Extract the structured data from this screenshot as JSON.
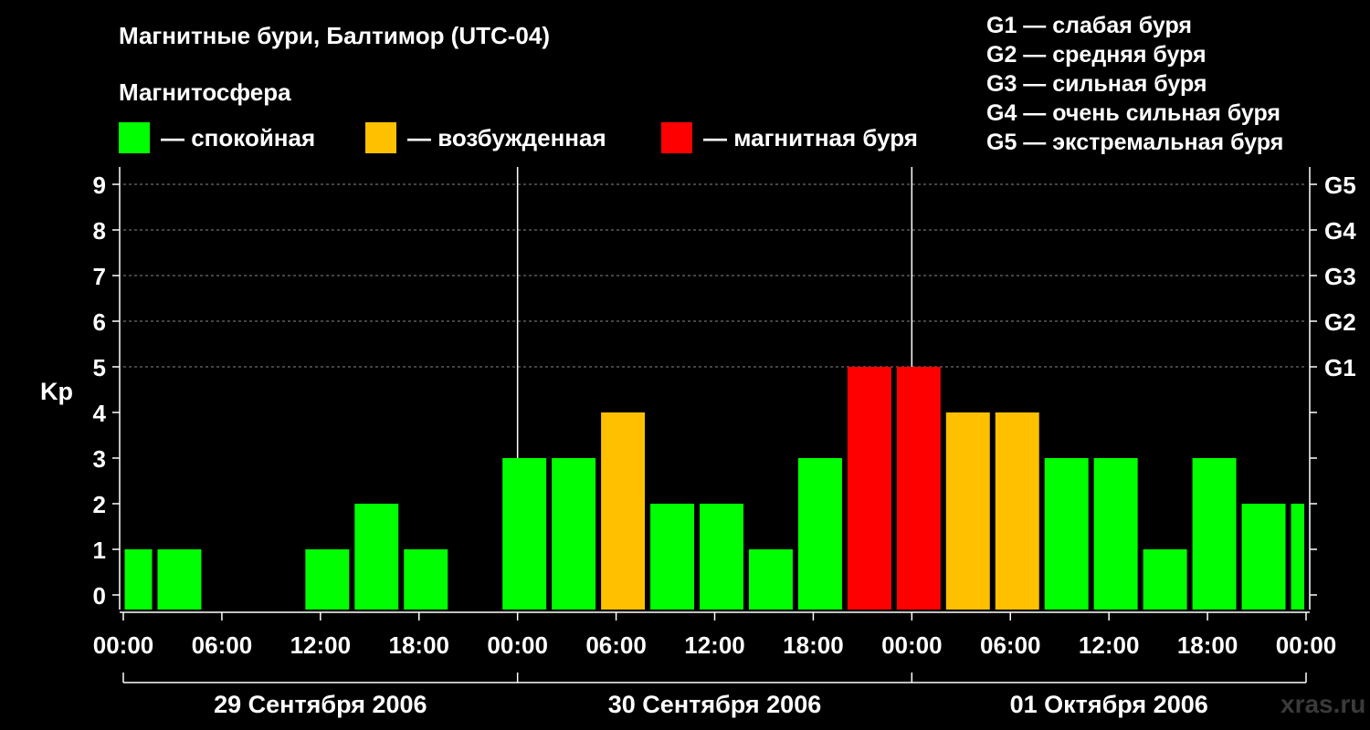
{
  "header": {
    "title": "Магнитные бури, Балтимор (UTC-04)",
    "subtitle": "Магнитосфера"
  },
  "legend": [
    {
      "label": "— спокойная",
      "color": "#00ff00"
    },
    {
      "label": "— возбужденная",
      "color": "#ffc000"
    },
    {
      "label": "— магнитная буря",
      "color": "#ff0000"
    }
  ],
  "g_legend": [
    "G1 — слабая буря",
    "G2 — средняя буря",
    "G3 — сильная буря",
    "G4 — очень сильная буря",
    "G5 — экстремальная буря"
  ],
  "watermark": "xras.ru",
  "chart_data": {
    "type": "bar",
    "ylabel": "Kp",
    "ylim": [
      0,
      9
    ],
    "yticks": [
      "0",
      "1",
      "2",
      "3",
      "4",
      "5",
      "6",
      "7",
      "8",
      "9"
    ],
    "g_scale": [
      {
        "label": "G1",
        "kp": 5
      },
      {
        "label": "G2",
        "kp": 6
      },
      {
        "label": "G3",
        "kp": 7
      },
      {
        "label": "G4",
        "kp": 8
      },
      {
        "label": "G5",
        "kp": 9
      }
    ],
    "xticks": [
      "00:00",
      "06:00",
      "12:00",
      "18:00",
      "00:00",
      "06:00",
      "12:00",
      "18:00",
      "00:00",
      "06:00",
      "12:00",
      "18:00",
      "00:00"
    ],
    "days": [
      "29 Сентября 2006",
      "30 Сентября 2006",
      "01 Октября 2006"
    ],
    "grid": "dashed horizontal lines at Kp 5-9",
    "colors": {
      "quiet": "#00ff00",
      "active": "#ffc000",
      "storm": "#ff0000"
    },
    "bars": [
      {
        "start": "2006-09-29 00:00",
        "end": "2006-09-29 02:00",
        "kp": 1
      },
      {
        "start": "2006-09-29 02:00",
        "end": "2006-09-29 05:00",
        "kp": 1
      },
      {
        "start": "2006-09-29 05:00",
        "end": "2006-09-29 08:00",
        "kp": 0
      },
      {
        "start": "2006-09-29 08:00",
        "end": "2006-09-29 11:00",
        "kp": 0
      },
      {
        "start": "2006-09-29 11:00",
        "end": "2006-09-29 14:00",
        "kp": 1
      },
      {
        "start": "2006-09-29 14:00",
        "end": "2006-09-29 17:00",
        "kp": 2
      },
      {
        "start": "2006-09-29 17:00",
        "end": "2006-09-29 20:00",
        "kp": 1
      },
      {
        "start": "2006-09-29 20:00",
        "end": "2006-09-29 23:00",
        "kp": 0
      },
      {
        "start": "2006-09-29 23:00",
        "end": "2006-09-30 02:00",
        "kp": 3
      },
      {
        "start": "2006-09-30 02:00",
        "end": "2006-09-30 05:00",
        "kp": 3
      },
      {
        "start": "2006-09-30 05:00",
        "end": "2006-09-30 08:00",
        "kp": 4
      },
      {
        "start": "2006-09-30 08:00",
        "end": "2006-09-30 11:00",
        "kp": 2
      },
      {
        "start": "2006-09-30 11:00",
        "end": "2006-09-30 14:00",
        "kp": 2
      },
      {
        "start": "2006-09-30 14:00",
        "end": "2006-09-30 17:00",
        "kp": 1
      },
      {
        "start": "2006-09-30 17:00",
        "end": "2006-09-30 20:00",
        "kp": 3
      },
      {
        "start": "2006-09-30 20:00",
        "end": "2006-09-30 23:00",
        "kp": 5
      },
      {
        "start": "2006-09-30 23:00",
        "end": "2006-10-01 02:00",
        "kp": 5
      },
      {
        "start": "2006-10-01 02:00",
        "end": "2006-10-01 05:00",
        "kp": 4
      },
      {
        "start": "2006-10-01 05:00",
        "end": "2006-10-01 08:00",
        "kp": 4
      },
      {
        "start": "2006-10-01 08:00",
        "end": "2006-10-01 11:00",
        "kp": 3
      },
      {
        "start": "2006-10-01 11:00",
        "end": "2006-10-01 14:00",
        "kp": 3
      },
      {
        "start": "2006-10-01 14:00",
        "end": "2006-10-01 17:00",
        "kp": 1
      },
      {
        "start": "2006-10-01 17:00",
        "end": "2006-10-01 20:00",
        "kp": 3
      },
      {
        "start": "2006-10-01 20:00",
        "end": "2006-10-01 23:00",
        "kp": 2
      },
      {
        "start": "2006-10-01 23:00",
        "end": "2006-10-02 00:00",
        "kp": 2
      }
    ]
  }
}
